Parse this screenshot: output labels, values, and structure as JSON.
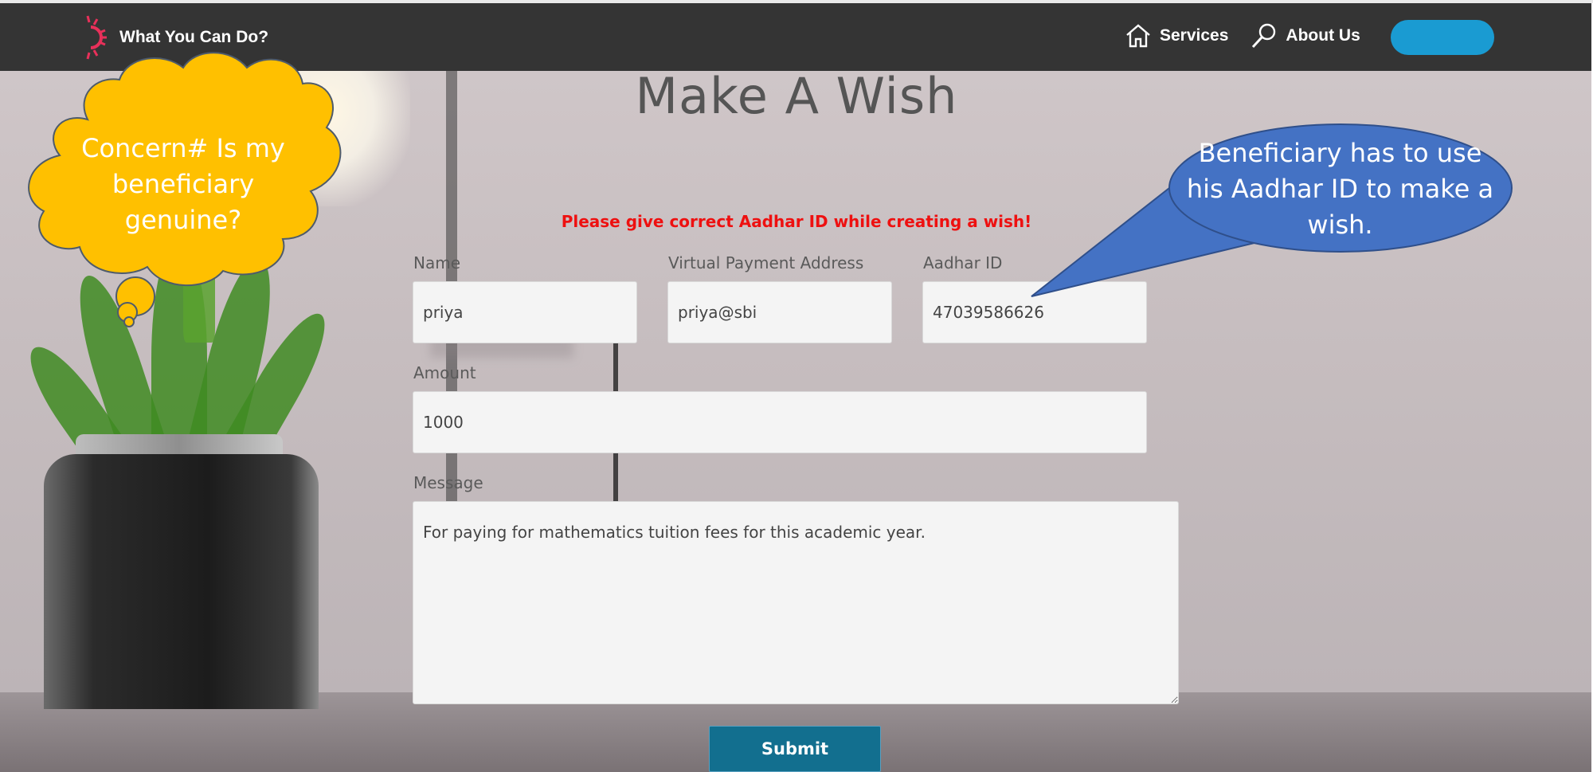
{
  "brand": {
    "name": "What You Can Do?"
  },
  "nav": {
    "items": [
      {
        "label": "Services",
        "icon": "home-icon"
      },
      {
        "label": "About Us",
        "icon": "search-icon"
      }
    ],
    "button_label": "",
    "button_color": "#1a9bd2"
  },
  "page": {
    "title": "Make A Wish",
    "warning": "Please give correct Aadhar ID while creating a wish!"
  },
  "form": {
    "name": {
      "label": "Name",
      "value": "priya"
    },
    "vpa": {
      "label": "Virtual Payment Address",
      "value": "priya@sbi"
    },
    "aadhar": {
      "label": "Aadhar ID",
      "value": "47039586626"
    },
    "amount": {
      "label": "Amount",
      "value": "1000"
    },
    "message": {
      "label": "Message",
      "value": "For paying for mathematics tuition fees for this academic year."
    },
    "submit_label": "Submit"
  },
  "callouts": {
    "concern": "Concern# Is my beneficiary genuine?",
    "info": "Beneficiary has to use his Aadhar ID to make a wish."
  },
  "colors": {
    "header_bg": "#343434",
    "accent": "#1a9bd2",
    "warning": "#ee1010",
    "submit_bg": "#126f8f",
    "cloud_fill": "#ffc000",
    "bubble_fill": "#4472c4"
  }
}
